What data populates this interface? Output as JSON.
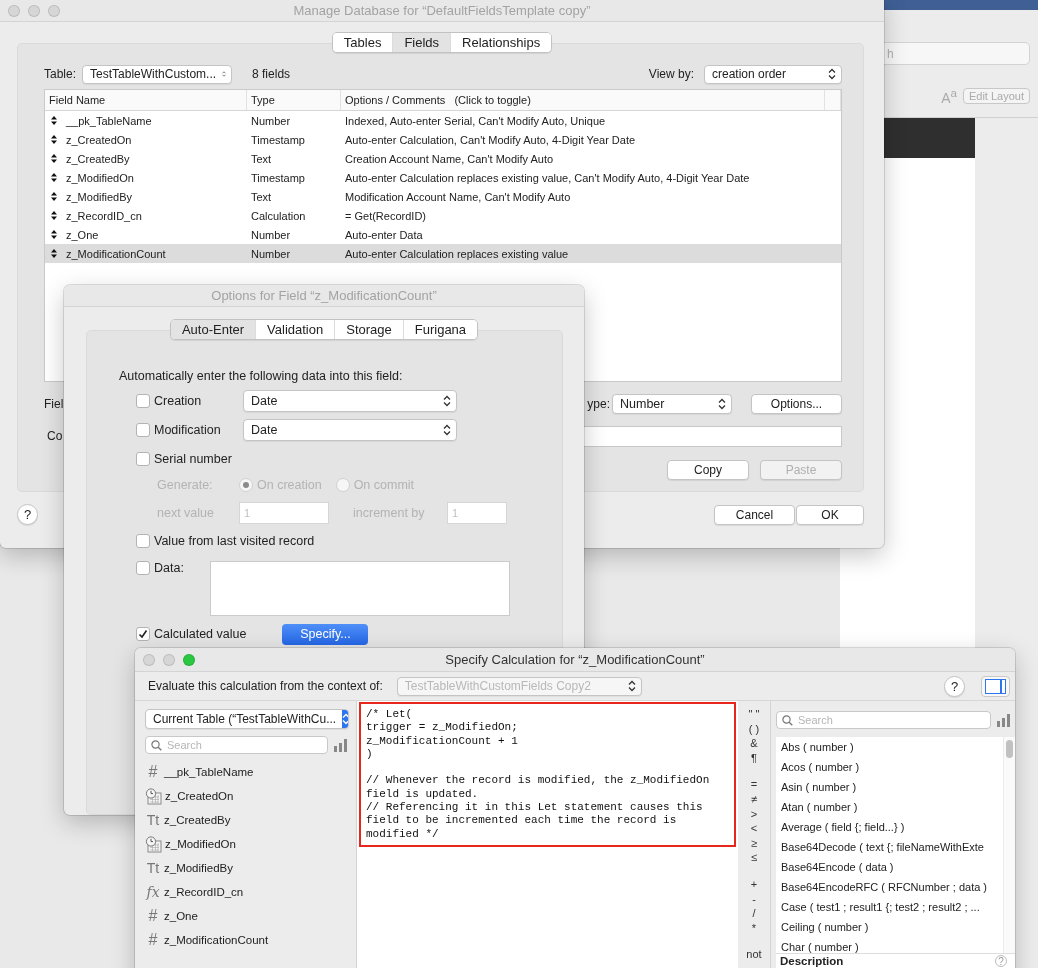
{
  "background_window": {
    "search_placeholder": "h",
    "format_glyph": "A$^{a}$",
    "edit_layout_button": "Edit Layout"
  },
  "manage_database": {
    "title": "Manage Database for “DefaultFieldsTemplate copy”",
    "focused": false,
    "tabs": [
      {
        "label": "Tables",
        "selected": false
      },
      {
        "label": "Fields",
        "selected": true
      },
      {
        "label": "Relationships",
        "selected": false
      }
    ],
    "table_label": "Table:",
    "table_select": "TestTableWithCustom...",
    "field_count": "8 fields",
    "view_by_label": "View by:",
    "view_by_select": "creation order",
    "columns": [
      "Field Name",
      "Type",
      "Options / Comments   (Click to toggle)"
    ],
    "rows": [
      {
        "name": "__pk_TableName",
        "type": "Number",
        "options": "Indexed, Auto-enter Serial, Can't Modify Auto, Unique",
        "selected": false
      },
      {
        "name": "z_CreatedOn",
        "type": "Timestamp",
        "options": "Auto-enter Calculation, Can't Modify Auto, 4-Digit Year Date",
        "selected": false
      },
      {
        "name": "z_CreatedBy",
        "type": "Text",
        "options": "Creation Account Name, Can't Modify Auto",
        "selected": false
      },
      {
        "name": "z_ModifiedOn",
        "type": "Timestamp",
        "options": "Auto-enter Calculation replaces existing value, Can't Modify Auto, 4-Digit Year Date",
        "selected": false
      },
      {
        "name": "z_ModifiedBy",
        "type": "Text",
        "options": "Modification Account Name, Can't Modify Auto",
        "selected": false
      },
      {
        "name": "z_RecordID_cn",
        "type": "Calculation",
        "options": "= Get(RecordID)",
        "selected": false
      },
      {
        "name": "z_One",
        "type": "Number",
        "options": "Auto-enter Data",
        "selected": false
      },
      {
        "name": "z_ModificationCount",
        "type": "Number",
        "options": "Auto-enter Calculation replaces existing value",
        "selected": true
      }
    ],
    "field_name_label": "Fiel",
    "comment_label": "Co",
    "type_label": "ype:",
    "type_select": "Number",
    "options_button": "Options...",
    "clipboard_buttons": [
      {
        "label": "Copy",
        "disabled": false
      },
      {
        "label": "Paste",
        "disabled": true
      }
    ],
    "help_button": "?",
    "cancel_button": "Cancel",
    "ok_button": "OK"
  },
  "options_dialog": {
    "title": "Options for Field “z_ModificationCount”",
    "tabs": [
      {
        "label": "Auto-Enter",
        "selected": true
      },
      {
        "label": "Validation",
        "selected": false
      },
      {
        "label": "Storage",
        "selected": false
      },
      {
        "label": "Furigana",
        "selected": false
      }
    ],
    "heading": "Automatically enter the following data into this field:",
    "options": [
      {
        "kind": "select",
        "label": "Creation",
        "checked": false,
        "value": "Date"
      },
      {
        "kind": "select",
        "label": "Modification",
        "checked": false,
        "value": "Date"
      },
      {
        "kind": "plain",
        "label": "Serial number",
        "checked": false
      },
      {
        "kind": "serial",
        "disabled": true,
        "generate_label": "Generate:",
        "choices": [
          {
            "label": "On creation",
            "selected": true
          },
          {
            "label": "On commit",
            "selected": false
          }
        ],
        "next_value_label": "next value",
        "next_value": "1",
        "increment_label": "increment by",
        "increment": "1"
      },
      {
        "kind": "plain",
        "label": "Value from last visited record",
        "checked": false
      },
      {
        "kind": "data",
        "label": "Data:",
        "checked": false
      },
      {
        "kind": "button",
        "label": "Calculated value",
        "checked": true,
        "button": "Specify..."
      }
    ]
  },
  "specify_calculation": {
    "title": "Specify Calculation for “z_ModificationCount”",
    "focused": true,
    "context_label": "Evaluate this calculation from the context of:",
    "context_select": "TestTableWithCustomFields Copy2",
    "context_disabled": true,
    "help_button": "?",
    "field_source": "Current Table (“TestTableWithCu...",
    "field_search_placeholder": "Search",
    "fields": [
      {
        "name": "__pk_TableName",
        "kind": "number",
        "glyph": "#"
      },
      {
        "name": "z_CreatedOn",
        "kind": "timestamp"
      },
      {
        "name": "z_CreatedBy",
        "kind": "text",
        "glyph": "Tt"
      },
      {
        "name": "z_ModifiedOn",
        "kind": "timestamp"
      },
      {
        "name": "z_ModifiedBy",
        "kind": "text",
        "glyph": "Tt"
      },
      {
        "name": "z_RecordID_cn",
        "kind": "calculation",
        "glyph": "fx"
      },
      {
        "name": "z_One",
        "kind": "number",
        "glyph": "#"
      },
      {
        "name": "z_ModificationCount",
        "kind": "number",
        "glyph": "#"
      }
    ],
    "formula": "/* Let(\ntrigger = z_ModifiedOn;\nz_ModificationCount + 1\n)\n\n// Whenever the record is modified, the z_ModifiedOn\nfield is updated.\n// Referencing it in this Let statement causes this\nfield to be incremented each time the record is\nmodified */",
    "operator_groups": [
      [
        "\" \"",
        "( )",
        "&",
        "¶"
      ],
      [
        "=",
        "≠",
        ">",
        "<",
        "≥",
        "≤"
      ],
      [
        "+",
        "-",
        "/",
        "*"
      ],
      [
        "not"
      ]
    ],
    "function_search_placeholder": "Search",
    "functions": [
      "Abs ( number )",
      "Acos ( number )",
      "Asin ( number )",
      "Atan ( number )",
      "Average ( field {; field...} )",
      "Base64Decode ( text {; fileNameWithExte",
      "Base64Encode ( data )",
      "Base64EncodeRFC ( RFCNumber ; data )",
      "Case ( test1 ; result1 {; test2 ; result2 ; ...",
      "Ceiling ( number )",
      "Char ( number )"
    ],
    "description_label": "Description",
    "description_help": "?"
  }
}
